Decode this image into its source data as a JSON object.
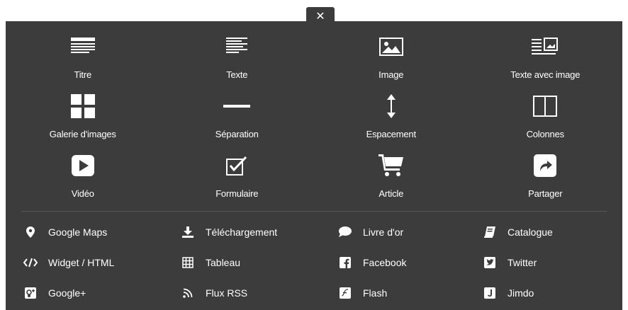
{
  "close": {
    "glyph": "✕"
  },
  "blocks": [
    {
      "label": "Titre",
      "icon": "title-icon"
    },
    {
      "label": "Texte",
      "icon": "text-icon"
    },
    {
      "label": "Image",
      "icon": "image-icon"
    },
    {
      "label": "Texte avec image",
      "icon": "text-with-image-icon"
    },
    {
      "label": "Galerie d'images",
      "icon": "gallery-icon"
    },
    {
      "label": "Séparation",
      "icon": "separator-icon"
    },
    {
      "label": "Espacement",
      "icon": "spacing-icon"
    },
    {
      "label": "Colonnes",
      "icon": "columns-icon"
    },
    {
      "label": "Vidéo",
      "icon": "video-icon"
    },
    {
      "label": "Formulaire",
      "icon": "form-icon"
    },
    {
      "label": "Article",
      "icon": "cart-icon"
    },
    {
      "label": "Partager",
      "icon": "share-icon"
    }
  ],
  "links": [
    {
      "label": "Google Maps",
      "icon": "map-pin-icon"
    },
    {
      "label": "Téléchargement",
      "icon": "download-icon"
    },
    {
      "label": "Livre d'or",
      "icon": "speech-bubble-icon"
    },
    {
      "label": "Catalogue",
      "icon": "catalogue-icon"
    },
    {
      "label": "Widget / HTML",
      "icon": "code-icon"
    },
    {
      "label": "Tableau",
      "icon": "table-icon"
    },
    {
      "label": "Facebook",
      "icon": "facebook-icon"
    },
    {
      "label": "Twitter",
      "icon": "twitter-icon"
    },
    {
      "label": "Google+",
      "icon": "google-plus-icon"
    },
    {
      "label": "Flux RSS",
      "icon": "rss-icon"
    },
    {
      "label": "Flash",
      "icon": "flash-icon"
    },
    {
      "label": "Jimdo",
      "icon": "jimdo-icon"
    }
  ],
  "colors": {
    "panel": "#3c3c3c",
    "text": "#ffffff",
    "divider": "#555555"
  }
}
